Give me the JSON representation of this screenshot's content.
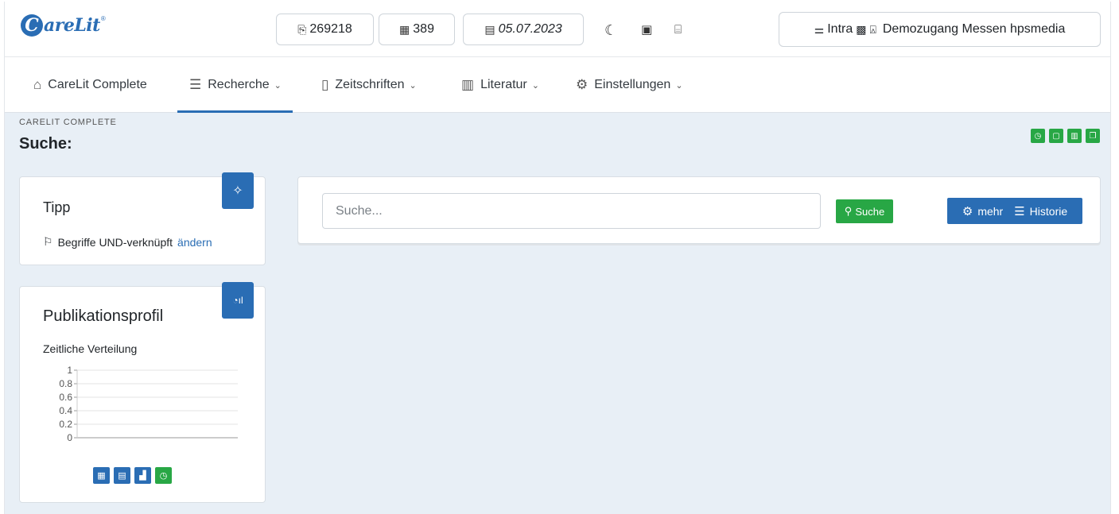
{
  "header": {
    "logo_text": "areLit",
    "logo_letter": "C",
    "logo_reg": "®",
    "stat_docs": "269218",
    "stat_journals": "389",
    "date": "05.07.2023",
    "user_mode": "Intra",
    "user_name": "Demozugang Messen hpsmedia"
  },
  "nav": {
    "home": "CareLit Complete",
    "recherche": "Recherche",
    "zeitschriften": "Zeitschriften",
    "literatur": "Literatur",
    "einstellungen": "Einstellungen"
  },
  "page": {
    "eyebrow": "CARELIT COMPLETE",
    "title": "Suche:"
  },
  "tipp": {
    "title": "Tipp",
    "text": "Begriffe UND-verknüpft",
    "link": "ändern"
  },
  "profil": {
    "title": "Publikationsprofil",
    "subtitle": "Zeitliche Verteilung"
  },
  "search": {
    "placeholder": "Suche...",
    "button": "Suche",
    "more": "mehr",
    "history": "Historie"
  },
  "chart_data": {
    "type": "line",
    "title": "",
    "xlabel": "",
    "ylabel": "",
    "ylim": [
      0,
      1
    ],
    "yticks": [
      "1",
      "0.8",
      "0.6",
      "0.4",
      "0.2",
      "0"
    ],
    "series": []
  },
  "colors": {
    "primary": "#2a6db4",
    "success": "#28a745",
    "background": "#e8eff6"
  }
}
